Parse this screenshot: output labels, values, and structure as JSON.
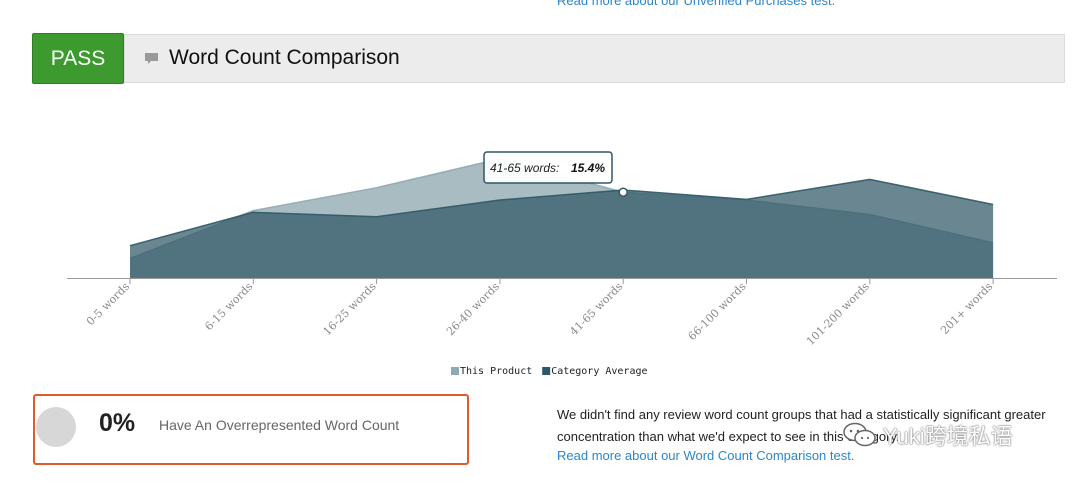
{
  "top_link": "Read more about our Unverified Purchases test.",
  "header": {
    "badge": "PASS",
    "title": "Word Count Comparison",
    "icon": "comment-icon"
  },
  "chart_data": {
    "type": "area",
    "categories": [
      "0-5 words",
      "6-15 words",
      "16-25 words",
      "26-40 words",
      "41-65 words",
      "66-100 words",
      "101-200 words",
      "201+ words"
    ],
    "series": [
      {
        "name": "This Product",
        "color": "#8fa9b0",
        "values": [
          3.5,
          12.1,
          16.2,
          21.4,
          15.4,
          14.0,
          11.4,
          6.3
        ]
      },
      {
        "name": "Category Average",
        "color": "#2f5866",
        "values": [
          5.8,
          11.8,
          11.0,
          14.0,
          15.8,
          14.1,
          17.7,
          13.2
        ]
      }
    ],
    "ylim": [
      0,
      28
    ],
    "tooltip": {
      "label": "41-65 words:",
      "value": "15.4%"
    },
    "legend_position": "bottom-center",
    "grid": false
  },
  "stat": {
    "value": "0%",
    "label": "Have An Overrepresented Word Count"
  },
  "description": "We didn't find any review word count groups that had a statistically significant greater concentration than what we'd expect to see in this category.",
  "description_link": "Read more about our Word Count Comparison test.",
  "watermark": {
    "text": "Yuki跨境私语",
    "icon": "wechat-icon"
  }
}
